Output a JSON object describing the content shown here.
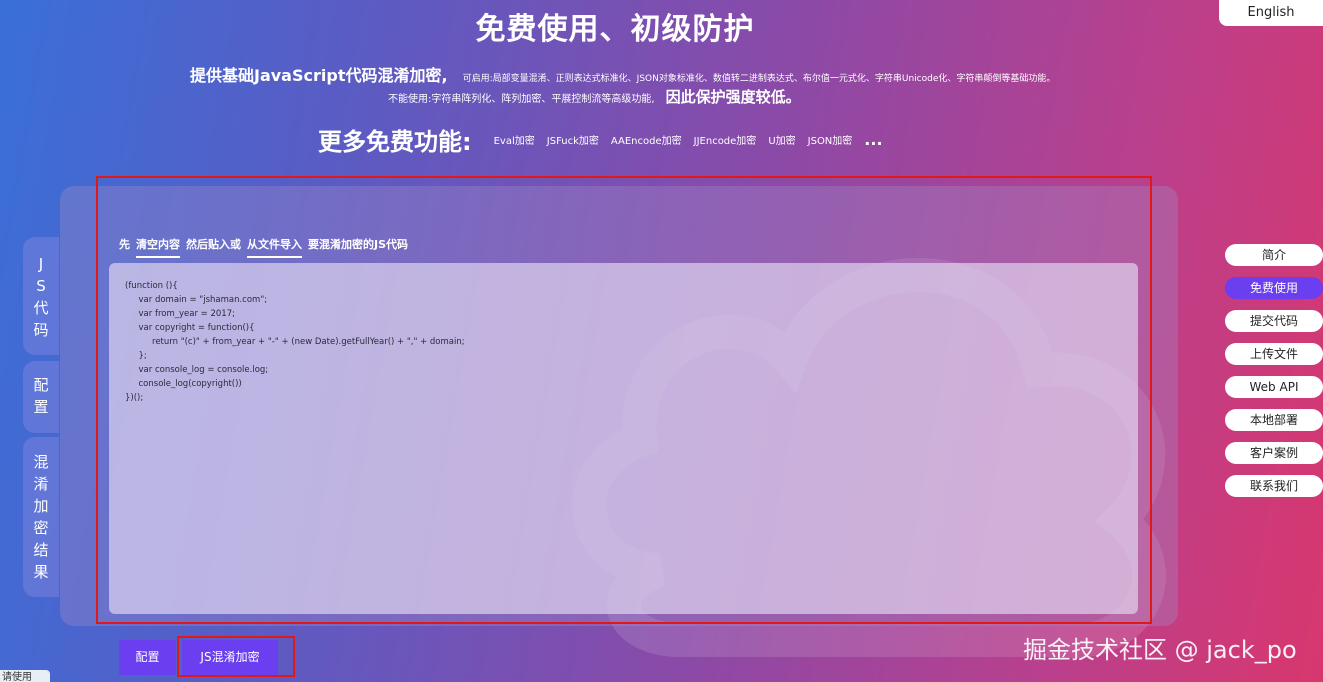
{
  "lang_button": "English",
  "title": "免费使用、初级防护",
  "line1": {
    "main": "提供基础JavaScript代码混淆加密,",
    "detail": "可启用:局部变量混淆、正则表达式标准化、JSON对象标准化、数值转二进制表达式、布尔值一元式化、字符串Unicode化、字符串颠倒等基础功能。"
  },
  "line2": {
    "detail": "不能使用:字符串阵列化、阵列加密、平展控制流等高级功能,",
    "main": "因此保护强度较低。"
  },
  "more": {
    "title": "更多免费功能:",
    "links": [
      "Eval加密",
      "JSFuck加密",
      "AAEncode加密",
      "JJEncode加密",
      "U加密",
      "JSON加密"
    ],
    "ellipsis": "..."
  },
  "hint": {
    "first": "先",
    "clear": "清空内容",
    "then": "然后贴入或",
    "import": "从文件导入",
    "target": "要混淆加密的JS代码"
  },
  "editor_code": "(function (){\n     var domain = \"jshaman.com\";\n     var from_year = 2017;\n     var copyright = function(){\n          return \"(c)\" + from_year + \"-\" + (new Date).getFullYear() + \",\" + domain;\n     };\n     var console_log = console.log;\n     console_log(copyright())\n})();",
  "left_tabs": [
    {
      "label": [
        "J",
        "S",
        "代",
        "码"
      ]
    },
    {
      "label": [
        "配",
        "置"
      ]
    },
    {
      "label": [
        "混",
        "淆",
        "加",
        "密",
        "结",
        "果"
      ]
    }
  ],
  "right_nav": [
    {
      "label": "简介",
      "active": false
    },
    {
      "label": "免费使用",
      "active": true
    },
    {
      "label": "提交代码",
      "active": false
    },
    {
      "label": "上传文件",
      "active": false
    },
    {
      "label": "Web API",
      "active": false
    },
    {
      "label": "本地部署",
      "active": false
    },
    {
      "label": "客户案例",
      "active": false
    },
    {
      "label": "联系我们",
      "active": false
    }
  ],
  "buttons": {
    "config": "配置",
    "encrypt": "JS混淆加密"
  },
  "watermark": "掘金技术社区 @ jack_po",
  "bottom_tag": "请使用",
  "colors": {
    "accent": "#6b3ef0",
    "highlight_border": "#e01818"
  }
}
